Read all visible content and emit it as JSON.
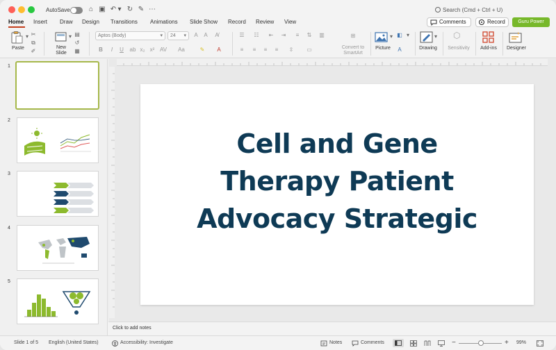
{
  "titlebar": {
    "autosave_label": "AutoSave",
    "search_placeholder": "Search (Cmd + Ctrl + U)"
  },
  "tabs": [
    "Home",
    "Insert",
    "Draw",
    "Design",
    "Transitions",
    "Animations",
    "Slide Show",
    "Record",
    "Review",
    "View"
  ],
  "header_buttons": {
    "comments": "Comments",
    "record": "Record",
    "guru": "Guru Power"
  },
  "ribbon": {
    "paste": "Paste",
    "new_slide_line1": "New",
    "new_slide_line2": "Slide",
    "font_name": "Aptos (Body)",
    "font_size": "24",
    "convert_line1": "Convert to",
    "convert_line2": "SmartArt",
    "picture": "Picture",
    "drawing": "Drawing",
    "sensitivity": "Sensitivity",
    "addins": "Add-ins",
    "designer": "Designer"
  },
  "thumbnails": [
    {
      "number": "1"
    },
    {
      "number": "2"
    },
    {
      "number": "3"
    },
    {
      "number": "4"
    },
    {
      "number": "5"
    }
  ],
  "slide": {
    "title_line1": "Cell and Gene",
    "title_line2": "Therapy Patient",
    "title_line3": "Advocacy Strategic"
  },
  "notes_placeholder": "Click to add notes",
  "statusbar": {
    "slide_info": "Slide 1 of 5",
    "language": "English (United States)",
    "accessibility": "Accessibility: Investigate",
    "notes": "Notes",
    "comments": "Comments",
    "zoom": "99%"
  },
  "colors": {
    "accent_tab": "#c43e1c",
    "guru_button": "#77b82a",
    "title_text": "#0e3a55",
    "thumb_green": "#8dba2e",
    "thumb_navy": "#1f4a6e"
  }
}
